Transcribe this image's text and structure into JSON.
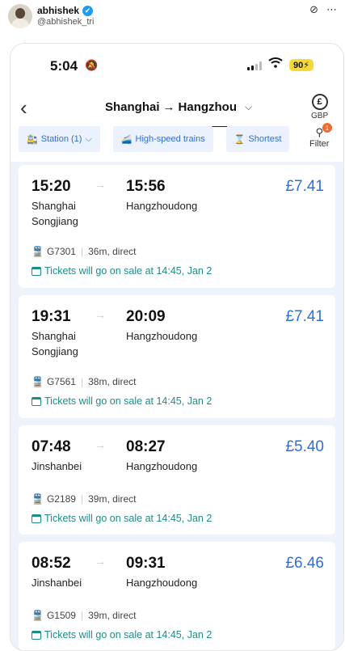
{
  "post": {
    "name": "abhishek",
    "handle": "@abhishek_tri",
    "verified_icon": "✔",
    "icons": [
      "grok-icon",
      "more-icon"
    ]
  },
  "status_bar": {
    "time": "5:04",
    "battery": "90"
  },
  "header": {
    "from": "Shanghai",
    "arrow": "→",
    "to": "Hangzhou",
    "currency": "GBP",
    "currency_symbol": "£"
  },
  "filters": [
    {
      "label": "Station (1)",
      "icon": "station-icon",
      "chevron": true
    },
    {
      "label": "High-speed trains",
      "icon": "train-icon",
      "chevron": false
    },
    {
      "label": "Shortest",
      "icon": "hourglass-icon",
      "chevron": false
    }
  ],
  "filter_button": {
    "label": "Filter",
    "badge": "1"
  },
  "trains": [
    {
      "dep_time": "15:20",
      "dep_station": "Shanghai Songjiang",
      "arr_time": "15:56",
      "arr_station": "Hangzhoudong",
      "price": "£7.41",
      "train_no": "G7301",
      "duration": "36m, direct",
      "sale": "Tickets will go on sale at 14:45, Jan 2"
    },
    {
      "dep_time": "19:31",
      "dep_station": "Shanghai Songjiang",
      "arr_time": "20:09",
      "arr_station": "Hangzhoudong",
      "price": "£7.41",
      "train_no": "G7561",
      "duration": "38m, direct",
      "sale": "Tickets will go on sale at 14:45, Jan 2"
    },
    {
      "dep_time": "07:48",
      "dep_station": "Jinshanbei",
      "arr_time": "08:27",
      "arr_station": "Hangzhoudong",
      "price": "£5.40",
      "train_no": "G2189",
      "duration": "39m, direct",
      "sale": "Tickets will go on sale at 14:45, Jan 2"
    },
    {
      "dep_time": "08:52",
      "dep_station": "Jinshanbei",
      "arr_time": "09:31",
      "arr_station": "Hangzhoudong",
      "price": "£6.46",
      "train_no": "G1509",
      "duration": "39m, direct",
      "sale": "Tickets will go on sale at 14:45, Jan 2"
    }
  ]
}
